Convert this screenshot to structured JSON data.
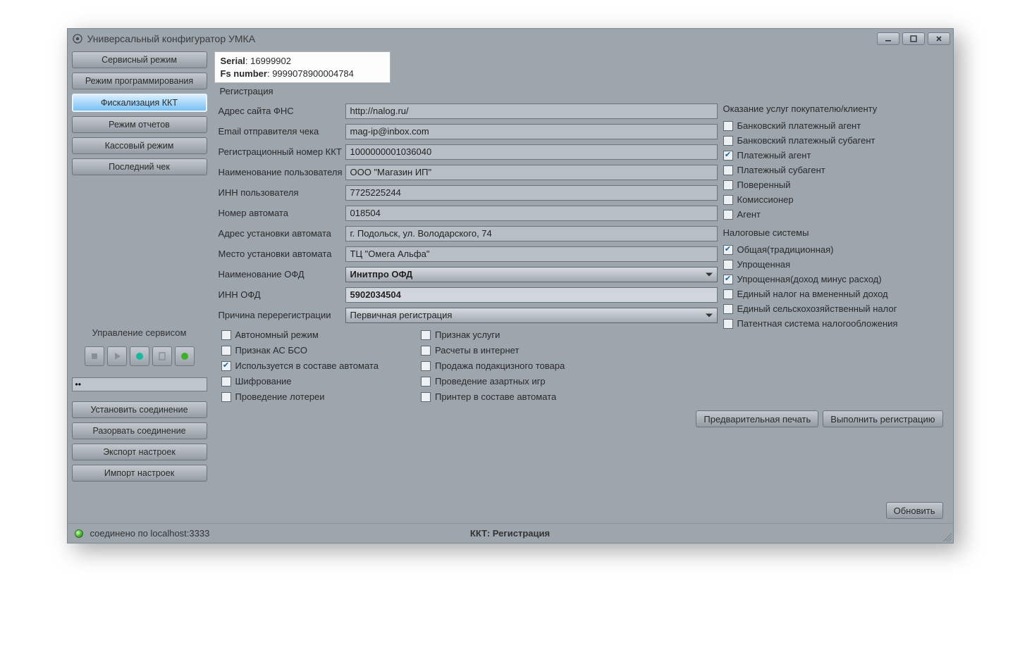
{
  "window": {
    "title": "Универсальный конфигуратор УМКА"
  },
  "info": {
    "serial_label": "Serial",
    "serial_value": "16999902",
    "fs_label": "Fs number",
    "fs_value": "9999078900004784"
  },
  "sidebar": {
    "nav": [
      "Сервисный режим",
      "Режим программирования",
      "Фискализация ККТ",
      "Режим отчетов",
      "Кассовый режим",
      "Последний чек"
    ],
    "service_label": "Управление сервисом",
    "dots_value": "••",
    "lower": [
      "Установить соединение",
      "Разорвать соединение",
      "Экспорт настроек",
      "Импорт настроек"
    ]
  },
  "reg": {
    "title": "Регистрация",
    "rows": {
      "fns": {
        "label": "Адрес сайта ФНС",
        "value": "http://nalog.ru/"
      },
      "email": {
        "label": "Email отправителя чека",
        "value": "mag-ip@inbox.com"
      },
      "regnum": {
        "label": "Регистрационный номер ККТ",
        "value": "1000000001036040"
      },
      "username": {
        "label": "Наименование пользователя",
        "value": "ООО \"Магазин ИП\""
      },
      "inn": {
        "label": "ИНН пользователя",
        "value": "7725225244"
      },
      "auto_no": {
        "label": "Номер автомата",
        "value": "018504"
      },
      "addr": {
        "label": "Адрес установки автомата",
        "value": "г. Подольск, ул. Володарского, 74"
      },
      "place": {
        "label": "Место установки автомата",
        "value": "ТЦ \"Омега Альфа\""
      },
      "ofd": {
        "label": "Наименование ОФД",
        "value": "Инитпро ОФД"
      },
      "ofd_inn": {
        "label": "ИНН ОФД",
        "value": "5902034504"
      },
      "reason": {
        "label": "Причина перерегистрации",
        "value": "Первичная регистрация"
      }
    },
    "checks_left": [
      {
        "label": "Автономный режим",
        "checked": false
      },
      {
        "label": "Признак АС БСО",
        "checked": false
      },
      {
        "label": "Используется в составе автомата",
        "checked": true
      },
      {
        "label": "Шифрование",
        "checked": false
      },
      {
        "label": "Проведение лотереи",
        "checked": false
      }
    ],
    "checks_right": [
      {
        "label": "Признак услуги",
        "checked": false
      },
      {
        "label": "Расчеты в интернет",
        "checked": false
      },
      {
        "label": "Продажа подакцизного товара",
        "checked": false
      },
      {
        "label": "Проведение азартных игр",
        "checked": false
      },
      {
        "label": "Принтер в составе автомата",
        "checked": false
      }
    ]
  },
  "services": {
    "title": "Оказание услуг покупателю/клиенту",
    "items": [
      {
        "label": "Банковский платежный агент",
        "checked": false
      },
      {
        "label": "Банковский платежный субагент",
        "checked": false
      },
      {
        "label": "Платежный агент",
        "checked": true
      },
      {
        "label": "Платежный субагент",
        "checked": false
      },
      {
        "label": "Поверенный",
        "checked": false
      },
      {
        "label": "Комиссионер",
        "checked": false
      },
      {
        "label": "Агент",
        "checked": false
      }
    ]
  },
  "tax": {
    "title": "Налоговые системы",
    "items": [
      {
        "label": "Общая(традиционная)",
        "checked": true
      },
      {
        "label": "Упрощенная",
        "checked": false
      },
      {
        "label": "Упрощенная(доход минус расход)",
        "checked": true
      },
      {
        "label": "Единый налог на вмененный доход",
        "checked": false
      },
      {
        "label": "Единый сельскохозяйственный налог",
        "checked": false
      },
      {
        "label": "Патентная система налогообложения",
        "checked": false
      }
    ]
  },
  "actions": {
    "preview": "Предварительная печать",
    "register": "Выполнить регистрацию",
    "refresh": "Обновить"
  },
  "status": {
    "connected": "соединено по localhost:3333",
    "center": "ККТ: Регистрация"
  }
}
